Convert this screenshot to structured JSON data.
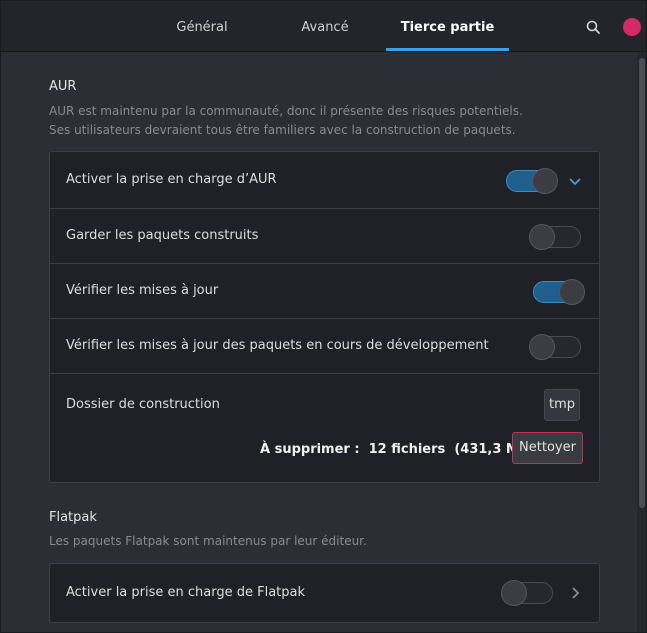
{
  "tabs": [
    {
      "label": "Général"
    },
    {
      "label": "Avancé"
    },
    {
      "label": "Tierce partie"
    }
  ],
  "icons": {
    "search": "search-icon",
    "close": "close-dot-icon",
    "expand": "chevron-down-icon",
    "more": "chevron-right-icon"
  },
  "colors": {
    "accent": "#3d9fe6",
    "close": "#d42a63",
    "danger_border": "#c4324f"
  },
  "aur": {
    "title": "AUR",
    "desc_line1": "AUR est maintenu par la communauté, donc il présente des risques potentiels.",
    "desc_line2": "Ses utilisateurs devraient tous être familiers avec la construction de paquets.",
    "rows": [
      {
        "label": "Activer la prise en charge d’AUR",
        "enabled": true
      },
      {
        "label": "Garder les paquets construits",
        "enabled": false
      },
      {
        "label": "Vérifier les mises à jour",
        "enabled": true
      },
      {
        "label": "Vérifier les mises à jour des paquets en cours de développement",
        "enabled": false
      }
    ],
    "build_dir_label": "Dossier de construction",
    "build_dir_value": "tmp",
    "to_delete_label": "À supprimer :",
    "to_delete_count": "12 fichiers",
    "to_delete_size": "(431,3 Mo)",
    "clean_label": "Nettoyer"
  },
  "flatpak": {
    "title": "Flatpak",
    "desc": "Les paquets Flatpak sont maintenus par leur éditeur.",
    "row_label": "Activer la prise en charge de Flatpak",
    "enabled": false
  }
}
